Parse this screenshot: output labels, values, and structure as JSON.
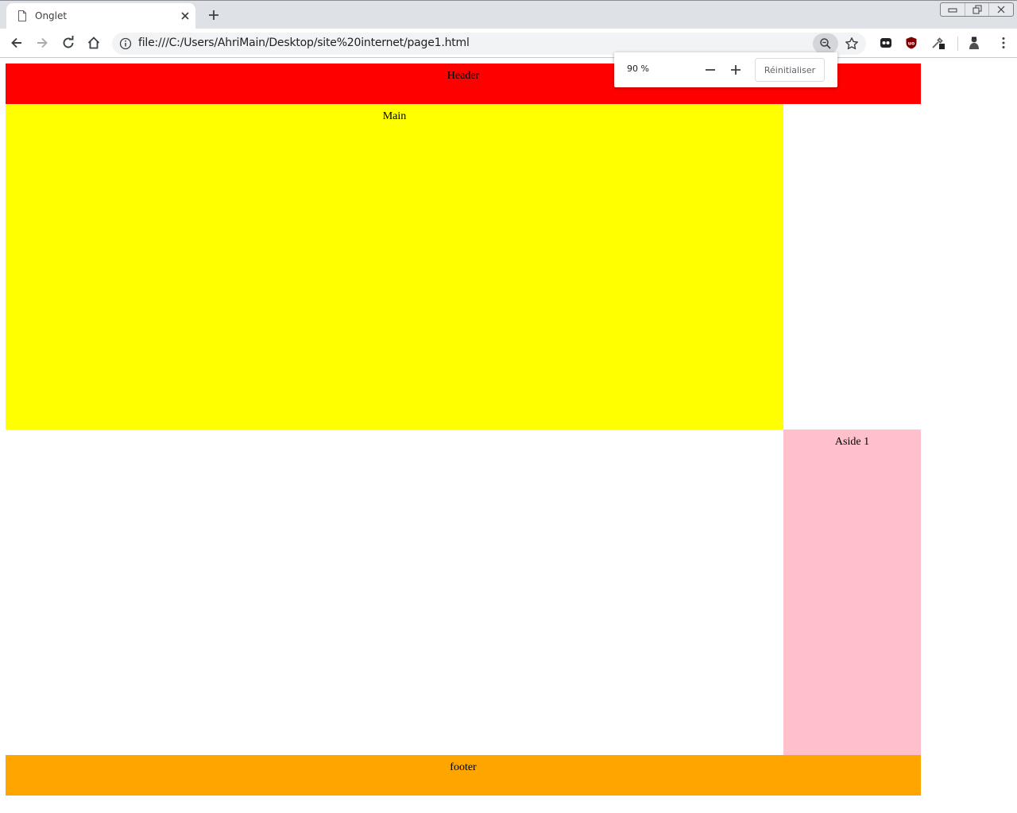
{
  "tab": {
    "title": "Onglet"
  },
  "address_bar": {
    "url": "file:///C:/Users/AhriMain/Desktop/site%20internet/page1.html"
  },
  "zoom_popup": {
    "level": "90 %",
    "reset_label": "Réinitialiser"
  },
  "page": {
    "header": {
      "label": "Header",
      "color": "#ff0000"
    },
    "main": {
      "label": "Main",
      "color": "#ffff00"
    },
    "aside": {
      "label": "Aside 1",
      "color": "#ffc0cb"
    },
    "footer": {
      "label": "footer",
      "color": "#ffa500"
    }
  },
  "icons": {
    "tab": [
      "page-icon",
      "close-icon",
      "plus-icon"
    ],
    "window": [
      "minimize-icon",
      "restore-icon",
      "close-window-icon"
    ],
    "toolbar": [
      "back-arrow-icon",
      "forward-arrow-icon",
      "reload-icon",
      "home-icon",
      "info-icon",
      "zoom-out-magnifier-icon",
      "star-icon"
    ],
    "extensions": [
      "ghostery-icon",
      "ublock-origin-icon",
      "eyedropper-icon",
      "profile-avatar-icon",
      "kebab-menu-icon"
    ]
  }
}
